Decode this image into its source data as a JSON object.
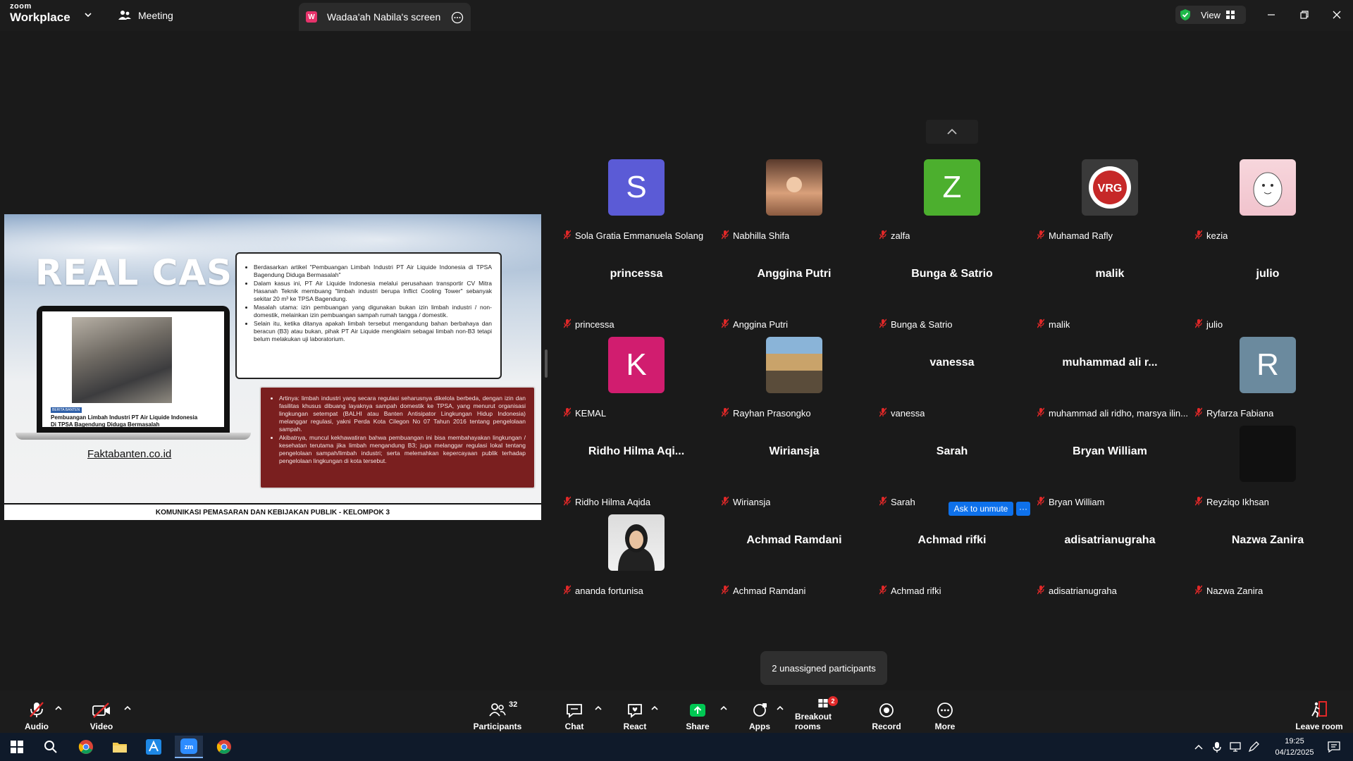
{
  "titlebar": {
    "brand_small": "zoom",
    "brand_big": "Workplace",
    "meeting_tab": "Meeting",
    "share_tab_badge": "W",
    "share_tab": "Wadaa'ah Nabila's screen",
    "view_label": "View"
  },
  "slide": {
    "heading": "REAL CASE",
    "laptop_tag": "BERITA BANTEN",
    "laptop_caption": "Pembuangan Limbah Industri PT Air Liquide Indonesia Di TPSA Bagendung Diduga Bermasalah",
    "source": "Faktabanten.co.id",
    "box1": [
      "Berdasarkan artikel \"Pembuangan Limbah Industri PT Air Liquide Indonesia di TPSA Bagendung Diduga Bermasalah\"",
      "Dalam kasus ini, PT Air Liquide Indonesia melalui perusahaan transportir CV Mitra Hasanah Teknik membuang \"limbah industri berupa Inflict Cooling Tower\" sebanyak sekitar 20 m³ ke TPSA Bagendung.",
      "Masalah utama: izin pembuangan yang digunakan bukan izin limbah industri / non-domestik, melainkan izin pembuangan sampah rumah tangga / domestik.",
      "Selain itu, ketika ditanya apakah limbah tersebut mengandung bahan berbahaya dan beracun (B3) atau bukan, pihak PT Air Liquide mengklaim sebagai limbah non-B3 tetapi belum melakukan uji laboratorium."
    ],
    "box2": [
      "Artinya: limbah industri yang secara regulasi seharusnya dikelola berbeda, dengan izin dan fasilitas khusus dibuang layaknya sampah domestik ke TPSA, yang menurut organisasi lingkungan setempat (BALHI atau Banten Antisipator Lingkungan Hidup Indonesia) melanggar regulasi, yakni Perda Kota Cilegon No 07 Tahun 2016 tentang pengelolaan sampah.",
      "Akibatnya, muncul kekhawatiran bahwa pembuangan ini bisa membahayakan lingkungan / kesehatan terutama jika limbah mengandung B3; juga melanggar regulasi lokal tentang pengelolaan sampah/limbah industri; serta melemahkan kepercayaan publik terhadap pengelolaan lingkungan di kota tersebut."
    ],
    "footer": "KOMUNIKASI PEMASARAN DAN KEBIJAKAN PUBLIK - KELOMPOK 3"
  },
  "participants": [
    {
      "label": "Sola Gratia Emmanuela Solang",
      "avatar_letter": "S",
      "avatar_color": "#5b5bd6",
      "type": "letter"
    },
    {
      "label": "Nabhilla Shifa",
      "type": "photo",
      "photo": "warm"
    },
    {
      "label": "zalfa",
      "avatar_letter": "Z",
      "avatar_color": "#4caf2e",
      "type": "letter"
    },
    {
      "label": "Muhamad Rafly",
      "type": "photo",
      "photo": "logo"
    },
    {
      "label": "kezia",
      "type": "photo",
      "photo": "cartoon"
    },
    {
      "label": "princessa",
      "bigname": "princessa",
      "type": "name"
    },
    {
      "label": "Anggina Putri",
      "bigname": "Anggina Putri",
      "type": "name"
    },
    {
      "label": "Bunga & Satrio",
      "bigname": "Bunga & Satrio",
      "type": "name"
    },
    {
      "label": "malik",
      "bigname": "malik",
      "type": "name"
    },
    {
      "label": "julio",
      "bigname": "julio",
      "type": "name"
    },
    {
      "label": "KEMAL",
      "avatar_letter": "K",
      "avatar_color": "#d11d6f",
      "type": "letter"
    },
    {
      "label": "Rayhan Prasongko",
      "type": "photo",
      "photo": "outdoor"
    },
    {
      "label": "vanessa",
      "bigname": "vanessa",
      "type": "name"
    },
    {
      "label": "muhammad ali ridho, marsya ilin...",
      "bigname": "muhammad ali r...",
      "type": "name"
    },
    {
      "label": "Ryfarza Fabiana",
      "avatar_letter": "R",
      "avatar_color": "#6b8a9e",
      "type": "letter"
    },
    {
      "label": "Ridho Hilma Aqida",
      "bigname": "Ridho Hilma Aqi...",
      "type": "name"
    },
    {
      "label": "Wiriansja",
      "bigname": "Wiriansja",
      "type": "name"
    },
    {
      "label": "Sarah",
      "bigname": "Sarah",
      "type": "name"
    },
    {
      "label": "Bryan William",
      "bigname": "Bryan William",
      "type": "name"
    },
    {
      "label": "Reyziqo Ikhsan",
      "type": "photo",
      "photo": "dark"
    },
    {
      "label": "ananda fortunisa",
      "type": "photo",
      "photo": "portrait"
    },
    {
      "label": "Achmad Ramdani",
      "bigname": "Achmad Ramdani",
      "type": "name"
    },
    {
      "label": "Achmad rifki",
      "bigname": "Achmad rifki",
      "type": "name"
    },
    {
      "label": "adisatrianugraha",
      "bigname": "adisatrianugraha",
      "type": "name"
    },
    {
      "label": "Nazwa Zanira",
      "bigname": "Nazwa Zanira",
      "type": "name"
    }
  ],
  "ask_unmute": "Ask to unmute",
  "ask_more": "···",
  "tooltip": "2 unassigned participants",
  "toolbar": {
    "audio": "Audio",
    "video": "Video",
    "participants": "Participants",
    "participants_count": "32",
    "chat": "Chat",
    "react": "React",
    "share": "Share",
    "apps": "Apps",
    "breakout": "Breakout rooms",
    "breakout_badge": "2",
    "record": "Record",
    "more": "More",
    "leave": "Leave room"
  },
  "taskbar": {
    "time": "19:25",
    "date": "04/12/2025"
  },
  "colors": {
    "accent": "#0e71eb",
    "share_green": "#00c853",
    "muted_red": "#e02828"
  }
}
